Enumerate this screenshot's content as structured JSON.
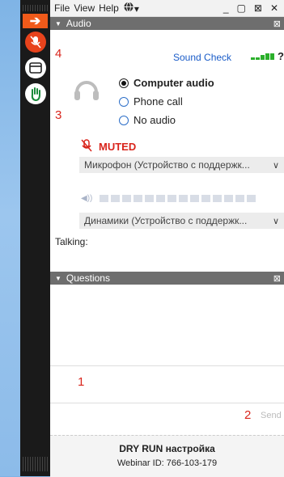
{
  "menu": {
    "file": "File",
    "view": "View",
    "help": "Help",
    "globe_icon": "globe-icon",
    "controls": [
      "_",
      "▢",
      "⊠",
      "✕"
    ]
  },
  "toolbar": {
    "icons": [
      "arrow-icon",
      "mic-muted-icon",
      "window-icon",
      "raise-hand-icon"
    ]
  },
  "audio": {
    "header": "Audio",
    "sound_check": "Sound Check",
    "help_mark": "?",
    "options": [
      "Computer audio",
      "Phone call",
      "No audio"
    ],
    "selected_option": "Computer audio",
    "muted_label": "MUTED",
    "microphone": "Микрофон (Устройство с поддержк...",
    "speakers": "Динамики (Устройство с поддержк...",
    "talking_label": "Talking:",
    "level_segments": 14
  },
  "questions": {
    "header": "Questions",
    "send_label": "Send"
  },
  "annotations": [
    "1",
    "2",
    "3",
    "4"
  ],
  "footer": {
    "title": "DRY RUN настройка",
    "webinar_id": "Webinar ID: 766-103-179"
  },
  "colors": {
    "accent": "#f05a1a",
    "muted_red": "#d9251c",
    "link_blue": "#1a5cc8",
    "signal_green": "#2bb02b",
    "header_gray": "#6e6e6e"
  }
}
